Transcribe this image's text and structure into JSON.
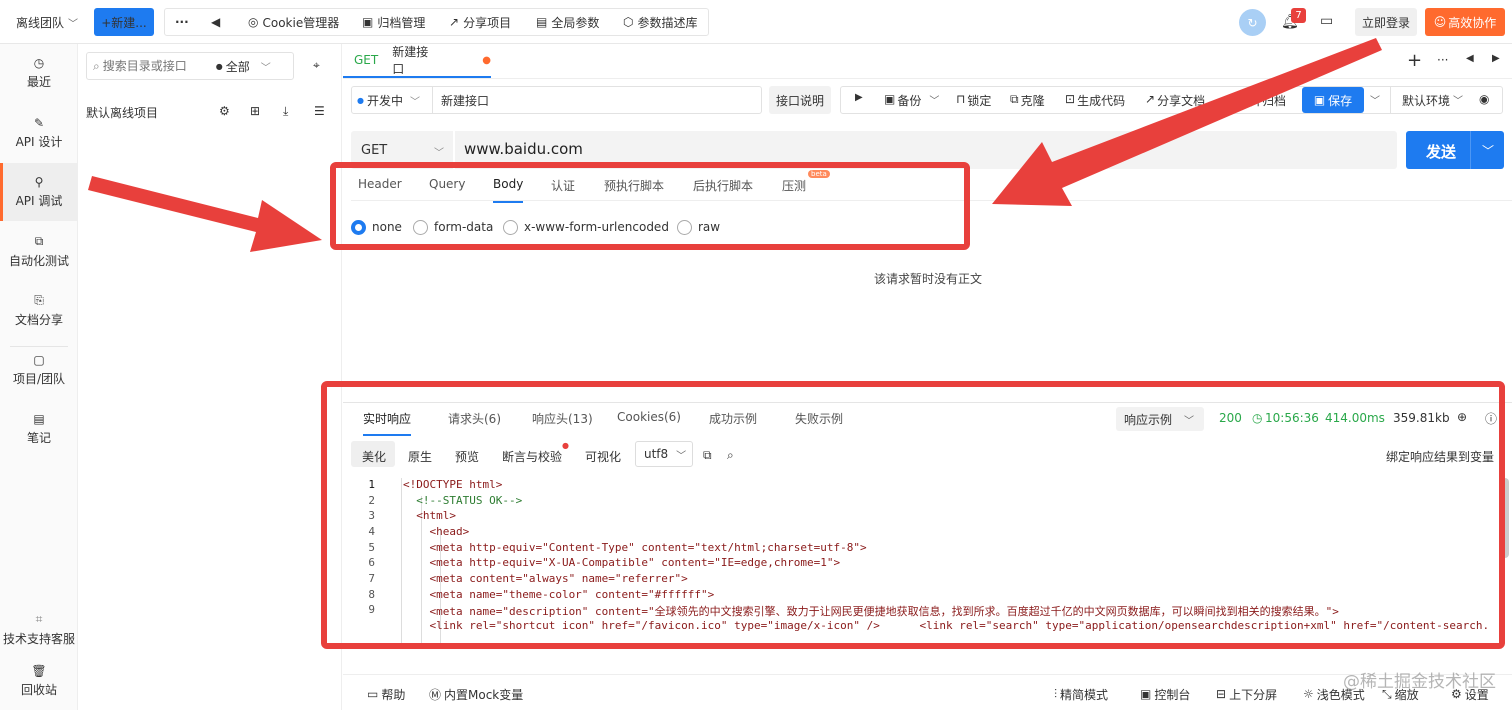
{
  "topbar": {
    "team": "离线团队",
    "new_btn": "+新建...",
    "more": "···",
    "items": [
      "Cookie管理器",
      "归档管理",
      "分享项目",
      "全局参数",
      "参数描述库"
    ],
    "notif_count": "7",
    "login": "立即登录",
    "collab": "高效协作"
  },
  "sidebar": {
    "items": [
      "最近",
      "API 设计",
      "API 调试",
      "自动化测试",
      "文档分享",
      "项目/团队",
      "笔记"
    ],
    "support": "技术支持客服",
    "trash": "回收站"
  },
  "tree": {
    "search_placeholder": "搜索目录或接口",
    "filter": "全部",
    "project": "默认离线项目"
  },
  "main": {
    "tab_method": "GET",
    "tab_title": "新建接口",
    "env_status": "开发中",
    "api_name": "新建接口",
    "doc_btn": "接口说明",
    "toolbar": [
      "备份",
      "锁定",
      "克隆",
      "生成代码",
      "分享文档",
      "保存并归档"
    ],
    "save": "保存",
    "env": "默认环境",
    "method": "GET",
    "url": "www.baidu.com",
    "send": "发送",
    "req_tabs": [
      "Header",
      "Query",
      "Body",
      "认证",
      "预执行脚本",
      "后执行脚本",
      "压测"
    ],
    "beta": "beta",
    "body_options": [
      "none",
      "form-data",
      "x-www-form-urlencoded",
      "raw"
    ],
    "no_body": "该请求暂时没有正文"
  },
  "response": {
    "tabs": [
      "实时响应",
      "请求头(6)",
      "响应头(13)",
      "Cookies(6)",
      "成功示例",
      "失败示例"
    ],
    "example": "响应示例",
    "status": "200",
    "time": "10:56:36",
    "duration": "414.00ms",
    "size": "359.81kb",
    "formats": [
      "美化",
      "原生",
      "预览",
      "断言与校验",
      "可视化"
    ],
    "encoding": "utf8",
    "bind": "绑定响应结果到变量"
  },
  "code": {
    "lines": [
      {
        "n": "1",
        "text": "<!DOCTYPE html>"
      },
      {
        "n": "2",
        "text": "  <!--STATUS OK-->"
      },
      {
        "n": "3",
        "text": "  <html>"
      },
      {
        "n": "4",
        "text": "    <head>"
      },
      {
        "n": "5",
        "text": "    <meta http-equiv=\"Content-Type\" content=\"text/html;charset=utf-8\">"
      },
      {
        "n": "6",
        "text": "    <meta http-equiv=\"X-UA-Compatible\" content=\"IE=edge,chrome=1\">"
      },
      {
        "n": "7",
        "text": "    <meta content=\"always\" name=\"referrer\">"
      },
      {
        "n": "8",
        "text": "    <meta name=\"theme-color\" content=\"#ffffff\">"
      },
      {
        "n": "9",
        "text": "    <meta name=\"description\" content=\"全球领先的中文搜索引擎、致力于让网民更便捷地获取信息，找到所求。百度超过千亿的中文网页数据库，可以瞬间找到相关的搜索结果。\">"
      },
      {
        "n": "",
        "text": "    <link rel=\"shortcut icon\" href=\"/favicon.ico\" type=\"image/x-icon\" />      <link rel=\"search\" type=\"application/opensearchdescription+xml\" href=\"/content-search."
      }
    ]
  },
  "footer": {
    "left": [
      "帮助",
      "内置Mock变量"
    ],
    "right": [
      "精简模式",
      "控制台",
      "上下分屏",
      "浅色模式",
      "缩放",
      "设置"
    ],
    "watermark": "@稀土掘金技术社区"
  },
  "colors": {
    "primary": "#1e7bf0",
    "accent": "#ff6a2e",
    "annotation": "#e8403c",
    "status": "#2aa84a"
  }
}
